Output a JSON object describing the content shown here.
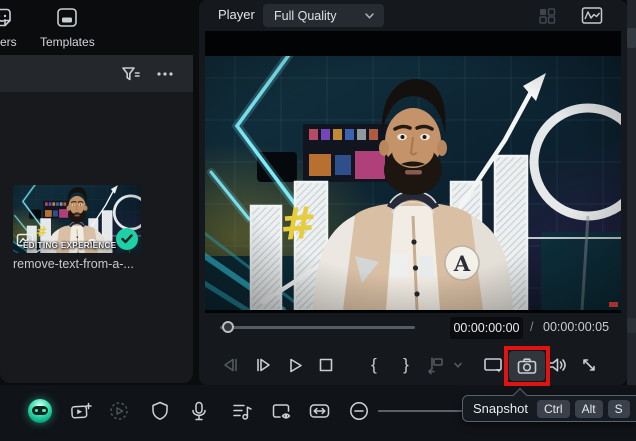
{
  "tabs": {
    "stickers_label": "ckers",
    "templates_label": "Templates"
  },
  "library": {
    "filename": "remove-text-from-a-...",
    "thumbnail_caption": "EDITING EXPERIENCE"
  },
  "player": {
    "title": "Player",
    "quality_selected": "Full Quality",
    "current_time": "00:00:00:00",
    "time_separator": "/",
    "total_time": "00:00:00:05"
  },
  "transport": {
    "mark_in_glyph": "{",
    "mark_out_glyph": "}"
  },
  "tooltip": {
    "label": "Snapshot",
    "keys": [
      "Ctrl",
      "Alt",
      "S"
    ]
  },
  "colors": {
    "accent_teal": "#1fd0a7",
    "neon_cyan": "#7deaf8",
    "highlight_red": "#e01313",
    "hash_yellow": "#e6cd3d"
  },
  "icons": {
    "top": [
      "stickers-icon",
      "templates-icon",
      "filter-icon",
      "more-options-icon"
    ],
    "player_header": [
      "grid-view-icon",
      "scope-view-icon",
      "chevron-down-icon"
    ],
    "transport": [
      "previous-frame-icon",
      "next-frame-icon",
      "play-icon",
      "stop-icon",
      "mark-in-glyph",
      "mark-out-glyph",
      "insert-marker-icon",
      "chevron-down-icon",
      "second-screen-icon",
      "camera-snapshot-icon",
      "volume-icon",
      "fullscreen-icon"
    ],
    "bottom": [
      "ai-assistant-orb-icon",
      "add-video-icon",
      "play-circle-icon",
      "shield-icon",
      "microphone-icon",
      "music-list-icon",
      "preview-card-icon",
      "fit-width-icon",
      "zoom-out-icon"
    ],
    "badges": [
      "video-media-icon",
      "added-check-icon"
    ]
  }
}
